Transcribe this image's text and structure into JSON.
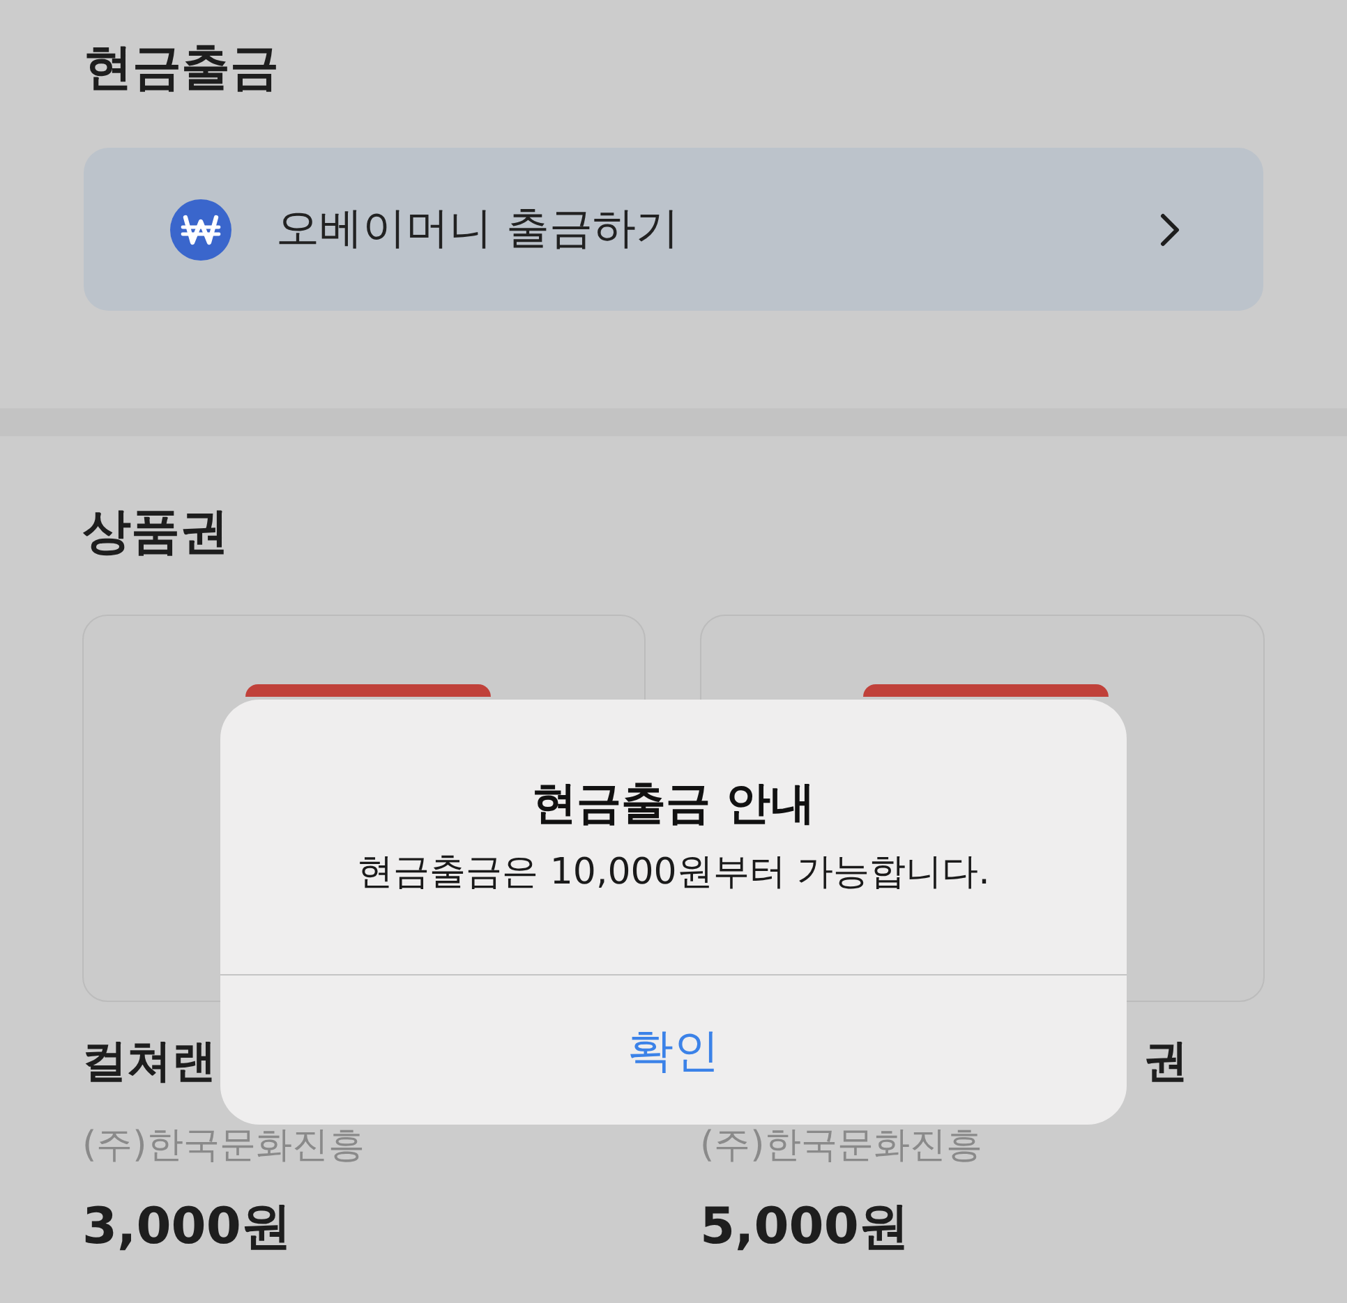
{
  "cash_withdrawal": {
    "title": "현금출금",
    "action": {
      "label": "오베이머니 출금하기"
    }
  },
  "gift_cards": {
    "title": "상품권",
    "items": [
      {
        "name": "컬쳐랜",
        "start_hidden": false,
        "issuer": "(주)한국문화진흥",
        "price": "3,000원"
      },
      {
        "name": "권",
        "start_hidden": true,
        "issuer": "(주)한국문화진흥",
        "price": "5,000원"
      }
    ]
  },
  "alert": {
    "title": "현금출금 안내",
    "message": "현금출금은 10,000원부터 가능합니다.",
    "buttons": [
      "확인"
    ]
  }
}
